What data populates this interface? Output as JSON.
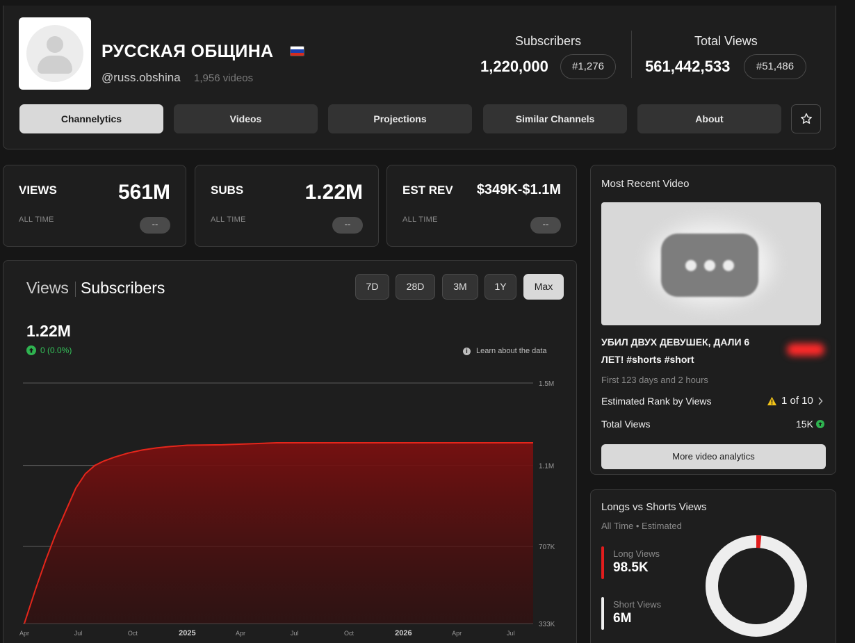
{
  "channel": {
    "name": "РУССКАЯ ОБЩИНА",
    "handle": "@russ.obshina",
    "video_count": "1,956 videos",
    "flag_colors": [
      "#ffffff",
      "#1c3fae",
      "#d52b1e"
    ]
  },
  "header_stats": {
    "subscribers_label": "Subscribers",
    "subscribers_value": "1,220,000",
    "subscribers_rank": "#1,276",
    "views_label": "Total Views",
    "views_value": "561,442,533",
    "views_rank": "#51,486"
  },
  "tabs": [
    "Channelytics",
    "Videos",
    "Projections",
    "Similar Channels",
    "About"
  ],
  "active_tab": "Channelytics",
  "metrics": [
    {
      "label": "VIEWS",
      "value": "561M",
      "sub": "ALL TIME",
      "pill": "--"
    },
    {
      "label": "SUBS",
      "value": "1.22M",
      "sub": "ALL TIME",
      "pill": "--"
    },
    {
      "label": "EST REV",
      "value": "$349K-$1.1M",
      "sub": "ALL TIME",
      "pill": "--"
    }
  ],
  "chart_panel": {
    "tab_views": "Views",
    "tab_subscribers": "Subscribers",
    "ranges": [
      "7D",
      "28D",
      "3M",
      "1Y",
      "Max"
    ],
    "active_range": "Max",
    "current_value": "1.22M",
    "change": "0 (0.0%)",
    "learn_link": "Learn about the data"
  },
  "chart_data": {
    "type": "area",
    "title": "",
    "xlabel": "",
    "ylabel": "",
    "y_ticks": [
      {
        "value": 1500000,
        "label": "1.5M"
      },
      {
        "value": 1100000,
        "label": "1.1M"
      },
      {
        "value": 707000,
        "label": "707K"
      },
      {
        "value": 333000,
        "label": "333K"
      }
    ],
    "ylim": [
      333000,
      1500000
    ],
    "x_ticks": [
      {
        "value": "2024-04-01",
        "label": "Apr"
      },
      {
        "value": "2024-07-01",
        "label": "Jul"
      },
      {
        "value": "2024-10-01",
        "label": "Oct"
      },
      {
        "value": "2025-01-01",
        "label": "2025",
        "bold": true
      },
      {
        "value": "2025-04-01",
        "label": "Apr"
      },
      {
        "value": "2025-07-01",
        "label": "Jul"
      },
      {
        "value": "2025-10-01",
        "label": "Oct"
      },
      {
        "value": "2026-01-01",
        "label": "2026",
        "bold": true
      },
      {
        "value": "2026-04-01",
        "label": "Apr"
      },
      {
        "value": "2026-07-01",
        "label": "Jul"
      }
    ],
    "xlim": [
      "2024-04-01",
      "2026-08-08"
    ],
    "grid": true,
    "color": "#e5261b",
    "series": [
      {
        "x": [
          "2024-04-01",
          "2024-04-20",
          "2024-05-07",
          "2024-05-23",
          "2024-06-10",
          "2024-06-27",
          "2024-07-13",
          "2024-07-29",
          "2024-08-12",
          "2024-08-31",
          "2024-09-23",
          "2024-10-17",
          "2024-11-10",
          "2024-12-04",
          "2025-01-01",
          "2025-03-01",
          "2025-06-01",
          "2025-09-01",
          "2025-12-01",
          "2026-03-01",
          "2026-06-01",
          "2026-08-08"
        ],
        "values": [
          333000,
          500000,
          640000,
          760000,
          880000,
          990000,
          1060000,
          1100000,
          1120000,
          1140000,
          1160000,
          1175000,
          1185000,
          1192000,
          1198000,
          1200000,
          1210000,
          1210000,
          1210000,
          1210000,
          1210000,
          1210000
        ]
      }
    ]
  },
  "recent_video": {
    "section_title": "Most Recent Video",
    "title": "УБИЛ ДВУХ ДЕВУШЕК, ДАЛИ 6 ЛЕТ! #shorts #short",
    "age": "First 123 days and 2 hours",
    "rank_label": "Estimated Rank by Views",
    "rank_value": "1 of 10",
    "views_label": "Total Views",
    "views_value": "15K",
    "button": "More video analytics"
  },
  "longs_shorts": {
    "title": "Longs vs Shorts Views",
    "subtitle": "All Time • Estimated",
    "long_label": "Long Views",
    "long_value": "98.5K",
    "short_label": "Short Views",
    "short_value": "6M",
    "long_fraction": 0.016,
    "long_color": "#e11d1d",
    "short_color": "#eeeeee"
  }
}
